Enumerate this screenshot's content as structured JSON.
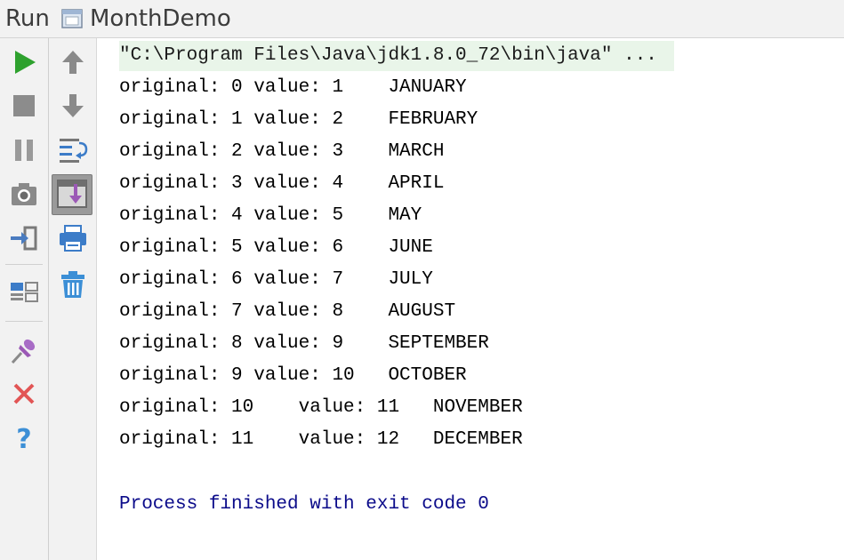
{
  "header": {
    "run_label": "Run",
    "config_name": "MonthDemo",
    "config_icon": "application-window-icon"
  },
  "toolbar_left": [
    {
      "icon": "run-icon"
    },
    {
      "icon": "stop-icon"
    },
    {
      "icon": "pause-icon"
    },
    {
      "icon": "camera-icon"
    },
    {
      "icon": "login-icon"
    },
    {
      "icon": "layout-icon"
    },
    {
      "icon": "pin-icon"
    },
    {
      "icon": "close-icon"
    },
    {
      "icon": "help-icon"
    }
  ],
  "toolbar_right": [
    {
      "icon": "arrow-up-icon"
    },
    {
      "icon": "arrow-down-icon"
    },
    {
      "icon": "soft-wrap-icon"
    },
    {
      "icon": "scroll-to-end-icon",
      "active": true
    },
    {
      "icon": "print-icon"
    },
    {
      "icon": "trash-icon"
    }
  ],
  "console": {
    "command": "\"C:\\Program Files\\Java\\jdk1.8.0_72\\bin\\java\" ...",
    "lines": [
      "original: 0 value: 1    JANUARY",
      "original: 1 value: 2    FEBRUARY",
      "original: 2 value: 3    MARCH",
      "original: 3 value: 4    APRIL",
      "original: 4 value: 5    MAY",
      "original: 5 value: 6    JUNE",
      "original: 6 value: 7    JULY",
      "original: 7 value: 8    AUGUST",
      "original: 8 value: 9    SEPTEMBER",
      "original: 9 value: 10   OCTOBER",
      "original: 10    value: 11   NOVEMBER",
      "original: 11    value: 12   DECEMBER"
    ],
    "exit_message": "Process finished with exit code 0"
  },
  "colors": {
    "run_green": "#2ea12e",
    "stop_gray": "#8c8c8c",
    "close_red": "#e25555",
    "help_blue": "#3c8fd6",
    "exit_text": "#0b0b8a",
    "command_bg": "#e9f5e9"
  }
}
